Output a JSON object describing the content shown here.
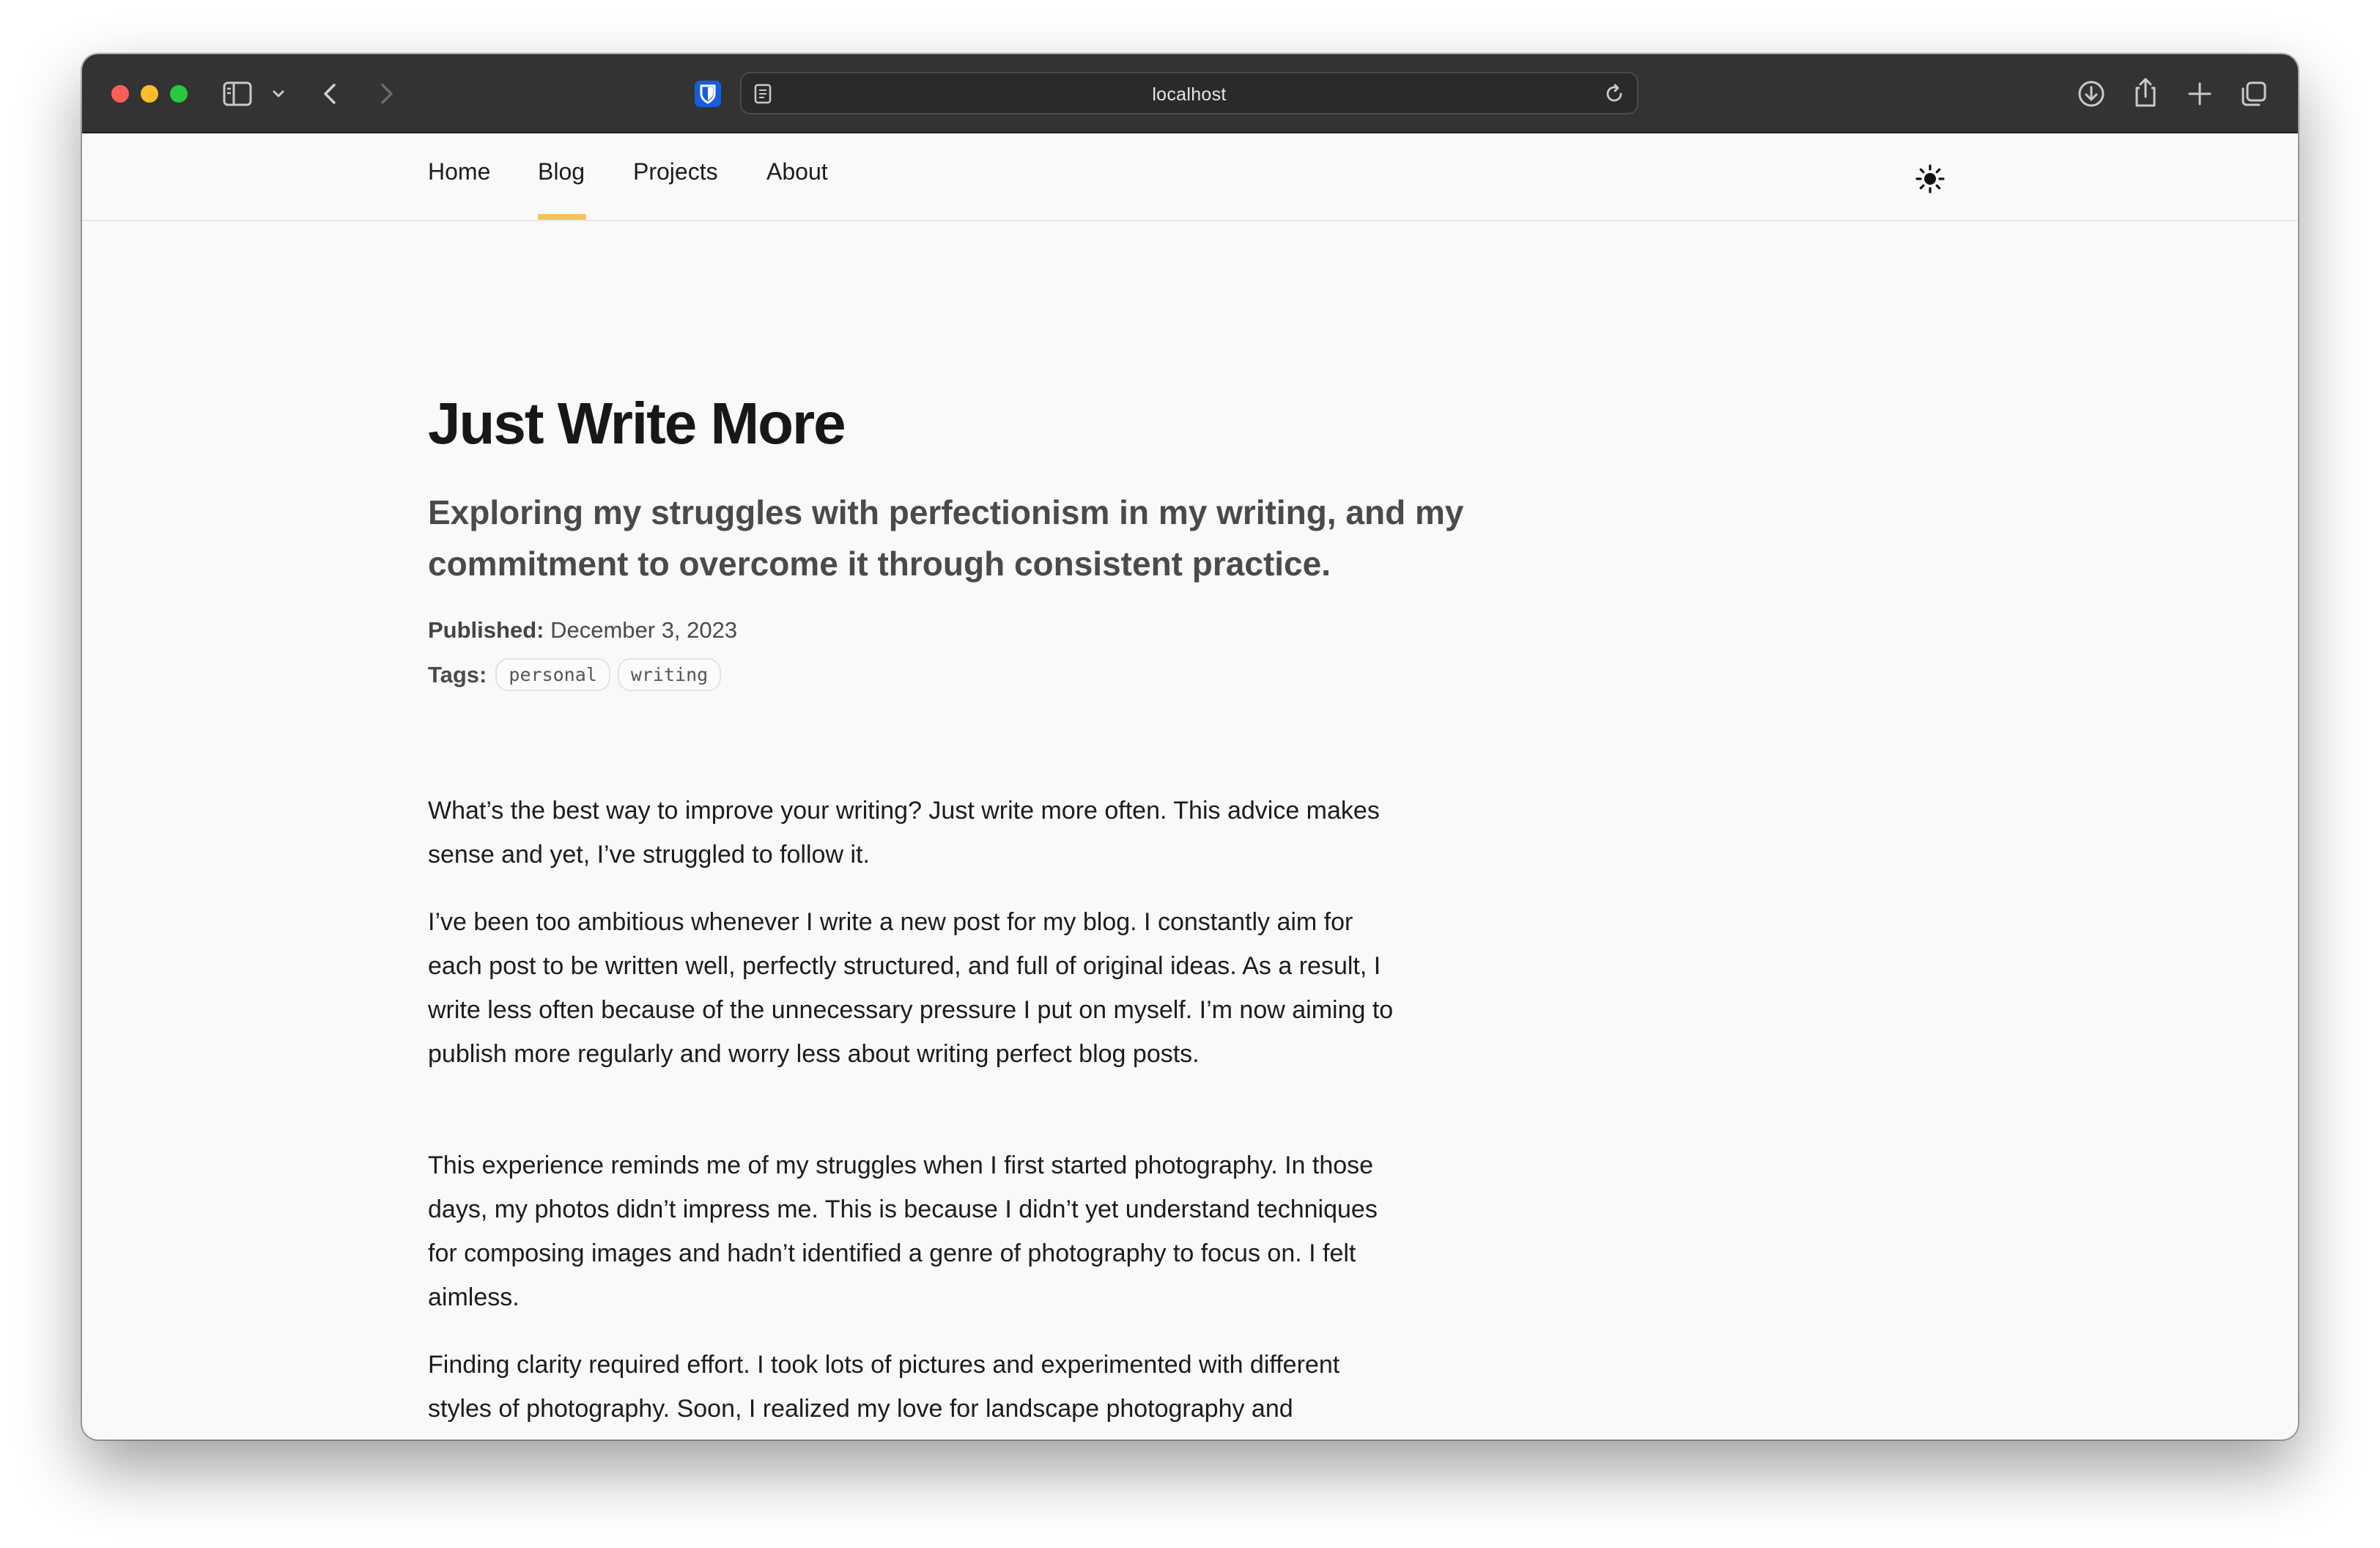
{
  "browser": {
    "url": "localhost",
    "icons": [
      "sidebar-icon",
      "chevron-down-icon",
      "back-icon",
      "forward-icon",
      "bitwarden-icon",
      "reader-icon",
      "reload-icon",
      "download-icon",
      "share-icon",
      "plus-icon",
      "tabs-icon"
    ]
  },
  "nav": {
    "items": [
      {
        "label": "Home"
      },
      {
        "label": "Blog"
      },
      {
        "label": "Projects"
      },
      {
        "label": "About"
      }
    ],
    "active": "Blog",
    "accent_color": "#f5c35b",
    "theme_icon": "sun-icon"
  },
  "post": {
    "title": "Just Write More",
    "subtitle": "Exploring my struggles with perfectionism in my writing, and my commitment to overcome it through consistent practice.",
    "published_label": "Published:",
    "published_date": "December 3, 2023",
    "tags_label": "Tags:",
    "tags": [
      "personal",
      "writing"
    ],
    "paragraphs": [
      "What’s the best way to improve your writing? Just write more often. This advice makes sense and yet, I’ve struggled to follow it.",
      "I’ve been too ambitious whenever I write a new post for my blog. I constantly aim for each post to be written well, perfectly structured, and full of original ideas. As a result, I write less often because of the unnecessary pressure I put on myself. I’m now aiming to publish more regularly and worry less about writing perfect blog posts.",
      "This experience reminds me of my struggles when I first started photography. In those days, my photos didn’t impress me. This is because I didn’t yet understand techniques for composing images and hadn’t identified a genre of photography to focus on. I felt aimless.",
      "Finding clarity required effort. I took lots of pictures and experimented with different styles of photography. Soon, I realized my love for landscape photography and developed my photographic eye. I’m going to take a similar approach to writing."
    ]
  }
}
